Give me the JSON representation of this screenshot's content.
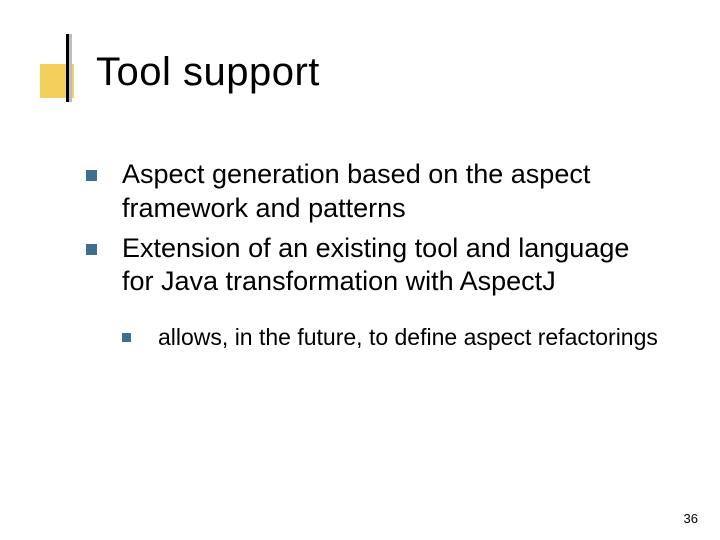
{
  "title": "Tool support",
  "bullets": [
    {
      "text": "Aspect generation based on the aspect framework and patterns"
    },
    {
      "text": "Extension of an existing tool and language for Java transformation with AspectJ"
    }
  ],
  "sub_bullets": [
    {
      "text": "allows, in the future, to define aspect refactorings"
    }
  ],
  "page_number": "36",
  "colors": {
    "accent_square": "#f4cf5b",
    "bullet": "#3f6f8c"
  }
}
